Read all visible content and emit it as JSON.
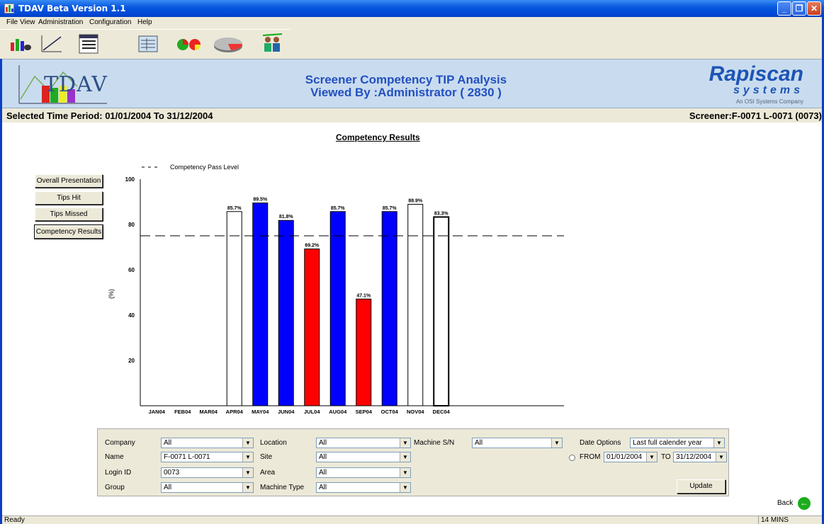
{
  "window": {
    "title": "TDAV Beta Version 1.1"
  },
  "menu": [
    "File",
    "View",
    "Administration",
    "Configuration",
    "Help"
  ],
  "toolbar": {
    "icons": [
      "bar-chart-icon",
      "line-chart-icon",
      "list-report-icon",
      "table-report-icon",
      "pie-chart-icon",
      "pie-3d-icon",
      "user-group-icon"
    ]
  },
  "header": {
    "logo_text": "TDAV",
    "title_line1": "Screener Competency TIP Analysis",
    "title_line2": "Viewed By :Administrator  ( 2830 )",
    "brand_name": "Rapiscan",
    "brand_sub": "systems",
    "brand_tag": "An OSI Systems Company"
  },
  "info": {
    "period": "Selected Time Period: 01/01/2004 To 31/12/2004",
    "screener": "Screener:F-0071 L-0071 (0073)"
  },
  "chart_heading": "Competency Results",
  "nav_buttons": [
    "Overall Presentation",
    "Tips Hit",
    "Tips Missed",
    "Competency Results"
  ],
  "chart_data": {
    "type": "bar",
    "categories": [
      "JAN04",
      "FEB04",
      "MAR04",
      "APR04",
      "MAY04",
      "JUN04",
      "JUL04",
      "AUG04",
      "SEP04",
      "OCT04",
      "NOV04",
      "DEC04"
    ],
    "values": [
      null,
      null,
      null,
      85.7,
      89.5,
      81.8,
      69.2,
      85.7,
      47.1,
      85.7,
      88.9,
      83.3
    ],
    "value_labels": [
      "",
      "",
      "",
      "85.7%",
      "89.5%",
      "81.8%",
      "69.2%",
      "85.7%",
      "47.1%",
      "85.7%",
      "88.9%",
      "83.3%"
    ],
    "fills": [
      "",
      "",
      "",
      "#ffffff",
      "#0000ff",
      "#0000ff",
      "#ff0000",
      "#0000ff",
      "#ff0000",
      "#0000ff",
      "#ffffff",
      "#ffffff"
    ],
    "pass_level": 75,
    "legend": "Competency Pass Level",
    "ylabel": "(%)",
    "yticks": [
      20,
      40,
      60,
      80,
      100
    ],
    "ylim": [
      0,
      100
    ],
    "legend_placement": "top-left",
    "grid": false
  },
  "filters": {
    "company": {
      "label": "Company",
      "value": "All"
    },
    "name": {
      "label": "Name",
      "value": "F-0071 L-0071"
    },
    "login_id": {
      "label": "Login ID",
      "value": "0073"
    },
    "group": {
      "label": "Group",
      "value": "All"
    },
    "location": {
      "label": "Location",
      "value": "All"
    },
    "site": {
      "label": "Site",
      "value": "All"
    },
    "area": {
      "label": "Area",
      "value": "All"
    },
    "machine_type": {
      "label": "Machine Type",
      "value": "All"
    },
    "machine_sn": {
      "label": "Machine S/N",
      "value": "All"
    },
    "date_options": {
      "label": "Date Options",
      "value": "Last full calender year"
    },
    "from": {
      "label": "FROM",
      "value": "01/01/2004"
    },
    "to": {
      "label": "TO",
      "value": "31/12/2004"
    },
    "update": "Update"
  },
  "back_label": "Back",
  "status": {
    "text": "Ready",
    "time": "14 MINS"
  },
  "colors": {
    "title_blue": "#2350c0",
    "header_bg": "#c9dcef",
    "pass_bar": "#0000ff",
    "fail_bar": "#ff0000"
  }
}
